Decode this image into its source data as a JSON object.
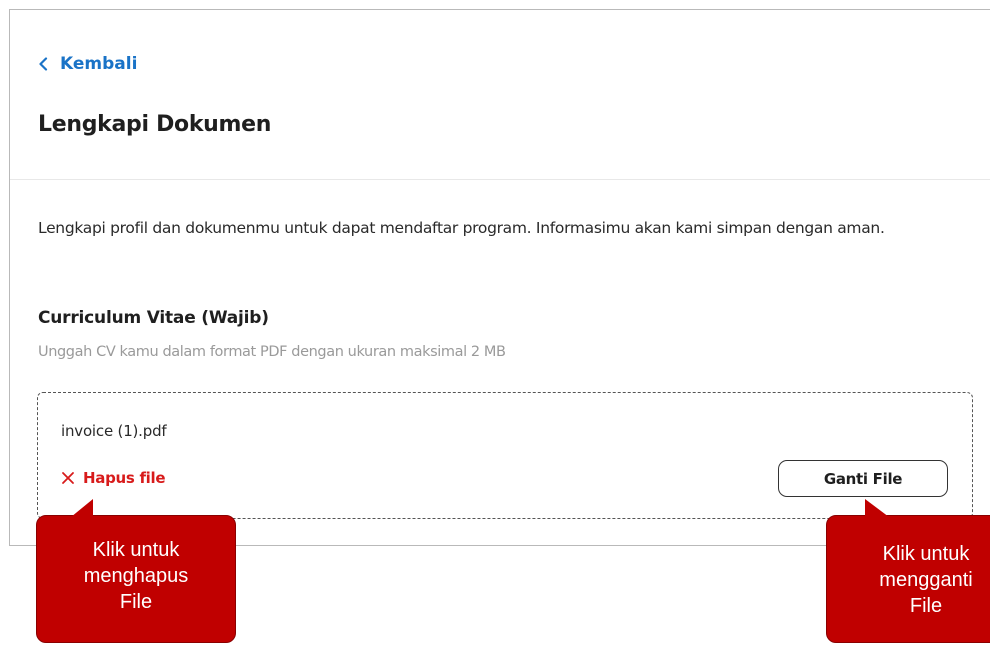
{
  "nav": {
    "back_label": "Kembali"
  },
  "page": {
    "title": "Lengkapi Dokumen",
    "intro": "Lengkapi profil dan dokumenmu untuk dapat mendaftar program. Informasimu akan kami simpan dengan aman."
  },
  "cv_section": {
    "title": "Curriculum Vitae (Wajib)",
    "hint": "Unggah CV kamu dalam format PDF dengan ukuran maksimal 2 MB",
    "file_name": "invoice (1).pdf",
    "delete_label": "Hapus file",
    "replace_label": "Ganti File"
  },
  "annotations": {
    "delete_callout": [
      "Klik untuk",
      "menghapus",
      "File"
    ],
    "replace_callout": [
      "Klik untuk",
      "mengganti",
      "File"
    ]
  },
  "colors": {
    "link_blue": "#1a73c7",
    "danger_red": "#d81b1b",
    "callout_red": "#c00000"
  },
  "icons": {
    "back": "chevron-left-icon",
    "delete": "close-icon"
  }
}
